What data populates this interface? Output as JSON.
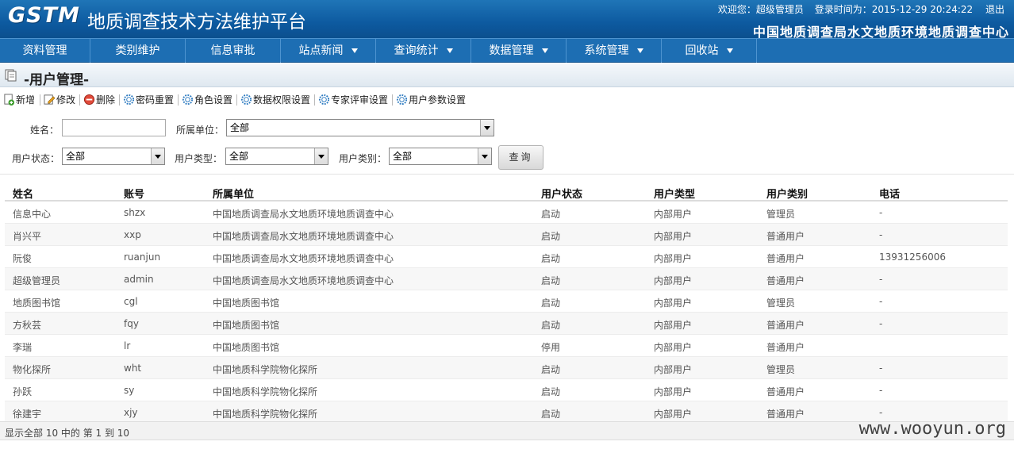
{
  "header": {
    "logo": "GSTM",
    "title": "地质调查技术方法维护平台",
    "welcome": "欢迎您：超级管理员",
    "login_time": "登录时间为：2015-12-29 20:24:22",
    "logout": "退出",
    "org_name": "中国地质调查局水文地质环境地质调查中心"
  },
  "nav": {
    "items": [
      {
        "label": "资料管理",
        "dropdown": false
      },
      {
        "label": "类别维护",
        "dropdown": false
      },
      {
        "label": "信息审批",
        "dropdown": false
      },
      {
        "label": "站点新闻",
        "dropdown": true
      },
      {
        "label": "查询统计",
        "dropdown": true
      },
      {
        "label": "数据管理",
        "dropdown": true
      },
      {
        "label": "系统管理",
        "dropdown": true
      },
      {
        "label": "回收站",
        "dropdown": true
      }
    ]
  },
  "page": {
    "title": "-用户管理-"
  },
  "toolbar": {
    "add": "新增",
    "edit": "修改",
    "delete": "删除",
    "reset_password": "密码重置",
    "role_settings": "角色设置",
    "data_permission": "数据权限设置",
    "expert_review": "专家评审设置",
    "user_params": "用户参数设置"
  },
  "search": {
    "name_label": "姓名：",
    "name_value": "",
    "unit_label": "所属单位：",
    "unit_value": "全部",
    "status_label": "用户状态：",
    "status_value": "全部",
    "type_label": "用户类型：",
    "type_value": "全部",
    "category_label": "用户类别：",
    "category_value": "全部",
    "query_button": "查询"
  },
  "table": {
    "columns": [
      "姓名",
      "账号",
      "所属单位",
      "用户状态",
      "用户类型",
      "用户类别",
      "电话"
    ],
    "rows": [
      [
        "信息中心",
        "shzx",
        "中国地质调查局水文地质环境地质调查中心",
        "启动",
        "内部用户",
        "管理员",
        "-"
      ],
      [
        "肖兴平",
        "xxp",
        "中国地质调查局水文地质环境地质调查中心",
        "启动",
        "内部用户",
        "普通用户",
        "-"
      ],
      [
        "阮俊",
        "ruanjun",
        "中国地质调查局水文地质环境地质调查中心",
        "启动",
        "内部用户",
        "普通用户",
        "13931256006"
      ],
      [
        "超级管理员",
        "admin",
        "中国地质调查局水文地质环境地质调查中心",
        "启动",
        "内部用户",
        "普通用户",
        "-"
      ],
      [
        "地质图书馆",
        "cgl",
        "中国地质图书馆",
        "启动",
        "内部用户",
        "管理员",
        "-"
      ],
      [
        "方秋芸",
        "fqy",
        "中国地质图书馆",
        "启动",
        "内部用户",
        "普通用户",
        "-"
      ],
      [
        "李瑞",
        "lr",
        "中国地质图书馆",
        "停用",
        "内部用户",
        "普通用户",
        ""
      ],
      [
        "物化探所",
        "wht",
        "中国地质科学院物化探所",
        "启动",
        "内部用户",
        "管理员",
        "-"
      ],
      [
        "孙跃",
        "sy",
        "中国地质科学院物化探所",
        "启动",
        "内部用户",
        "普通用户",
        "-"
      ],
      [
        "徐建宇",
        "xjy",
        "中国地质科学院物化探所",
        "启动",
        "内部用户",
        "普通用户",
        "-"
      ]
    ]
  },
  "pager": {
    "text": "显示全部 10 中的 第 1 到 10"
  },
  "watermark": "www.wooyun.org"
}
